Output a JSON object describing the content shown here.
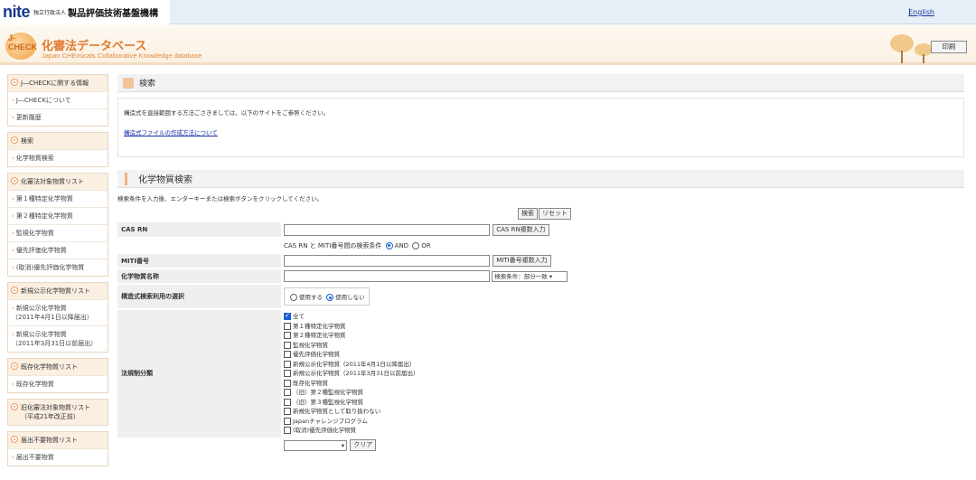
{
  "top": {
    "logo_word": "nite",
    "logo_small": "独立行政法人",
    "logo_big": "製品評価技術基盤機構",
    "separator": "|",
    "english_link": "English"
  },
  "header": {
    "logo_text": "J-CHECK",
    "title": "化審法データベース",
    "subtitle": "Japan CHEmicals Collaborative Knowledge database",
    "print_button": "印刷"
  },
  "sidebar": [
    {
      "title": "J―CHECKに関する情報",
      "items": [
        "J―CHECKについて",
        "更新履歴"
      ]
    },
    {
      "title": "検索",
      "items": [
        "化学物質検索"
      ]
    },
    {
      "title": "化審法対象物質リスト",
      "items": [
        "第１種特定化学物質",
        "第２種特定化学物質",
        "監視化学物質",
        "優先評価化学物質",
        "(取消)優先評価化学物質"
      ]
    },
    {
      "title": "新規公示化学物質リスト",
      "items": [
        "新規公示化学物質\n（2011年4月1日以降届出）",
        "新規公示化学物質\n（2011年3月31日以前届出）"
      ]
    },
    {
      "title": "既存化学物質リスト",
      "items": [
        "既存化学物質"
      ]
    },
    {
      "title": "旧化審法対象物質リスト\n（平成21年改正前）",
      "items": []
    },
    {
      "title": "届出不要物質リスト",
      "items": [
        "届出不要物質"
      ]
    }
  ],
  "search_section": {
    "title": "検索",
    "info_text": "構造式を直接範囲する方法ごさきましては、以下のサイトをご参照ください。",
    "info_link": "構造式ファイルの作成方法について"
  },
  "form_section": {
    "title": "化学物質検索",
    "instruction": "検索条件を入力後、エンターキーまたは検索ボタンをクリックしてください。",
    "search_button": "検索",
    "reset_button": "リセット",
    "cas_label": "CAS RN",
    "cas_bulk_button": "CAS RN複数入力",
    "condition_text": "CAS RN と MITI番号間の検索条件",
    "and_label": "AND",
    "or_label": "OR",
    "miti_label": "MITI番号",
    "miti_bulk_button": "MITI番号複数入力",
    "name_label": "化学物質名称",
    "name_match_select": "検索条件：部分一致",
    "structure_label": "構造式検索利用の選択",
    "structure_use": "使用する",
    "structure_nouse": "使用しない",
    "regulation_label": "法規制分類",
    "regulation_options": [
      {
        "label": "全て",
        "checked": true
      },
      {
        "label": "第１種特定化学物質",
        "checked": false
      },
      {
        "label": "第２種特定化学物質",
        "checked": false
      },
      {
        "label": "監視化学物質",
        "checked": false
      },
      {
        "label": "優先評価化学物質",
        "checked": false
      },
      {
        "label": "新規公示化学物質（2011年4月1日以降届出）",
        "checked": false
      },
      {
        "label": "新規公示化学物質（2011年3月31日以前届出）",
        "checked": false
      },
      {
        "label": "既存化学物質",
        "checked": false
      },
      {
        "label": "（旧）第２種監視化学物質",
        "checked": false
      },
      {
        "label": "（旧）第３種監視化学物質",
        "checked": false
      },
      {
        "label": "新規化学物質として取り扱わない",
        "checked": false
      },
      {
        "label": "Japanチャレンジプログラム",
        "checked": false
      },
      {
        "label": "(取消)優先評価化学物質",
        "checked": false
      }
    ],
    "clear_button": "クリア"
  }
}
